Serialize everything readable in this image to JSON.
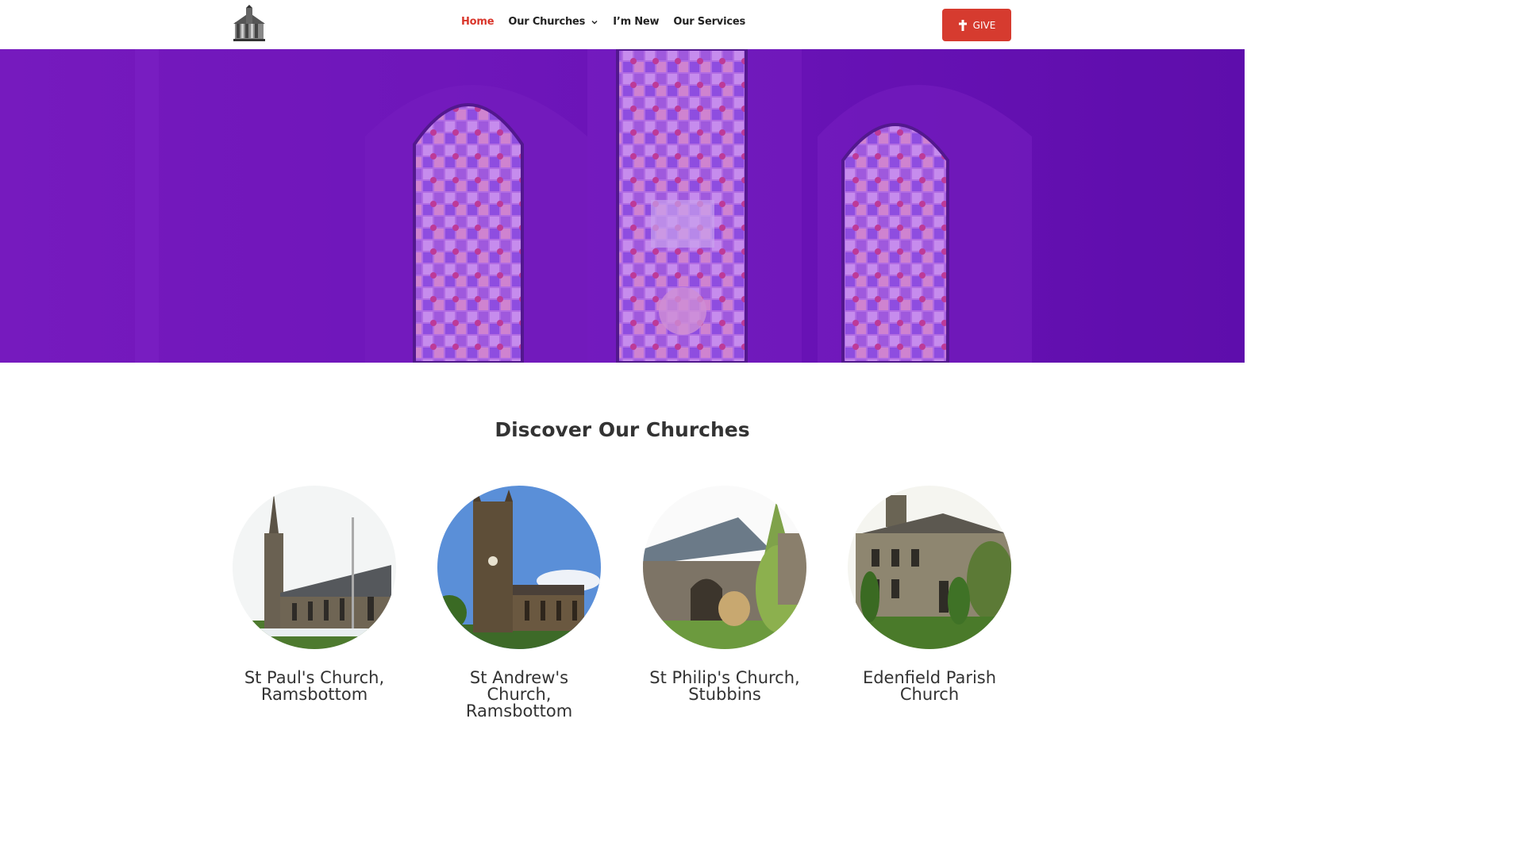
{
  "header": {
    "logo_icon": "church-logo-icon",
    "nav": [
      {
        "label": "Home",
        "active": true
      },
      {
        "label": "Our Churches",
        "has_dropdown": true
      },
      {
        "label": "I’m New"
      },
      {
        "label": "Our Services"
      }
    ],
    "give_button": {
      "label": "GIVE",
      "icon": "cross-icon"
    }
  },
  "hero": {
    "image": "stained-glass-windows",
    "tint": "#6a14b8"
  },
  "discover": {
    "title": "Discover Our Churches",
    "churches": [
      {
        "name": "St Paul's Church, Ramsbottom",
        "image": "st-pauls-church-photo"
      },
      {
        "name": "St Andrew's Church, Ramsbottom",
        "image": "st-andrews-church-photo"
      },
      {
        "name": "St Philip's Church, Stubbins",
        "image": "st-philips-church-photo"
      },
      {
        "name": "Edenfield Parish Church",
        "image": "edenfield-parish-church-photo"
      }
    ]
  },
  "colors": {
    "accent": "#d63b2f",
    "hero_purple": "#6a14b8",
    "text": "#333333"
  }
}
